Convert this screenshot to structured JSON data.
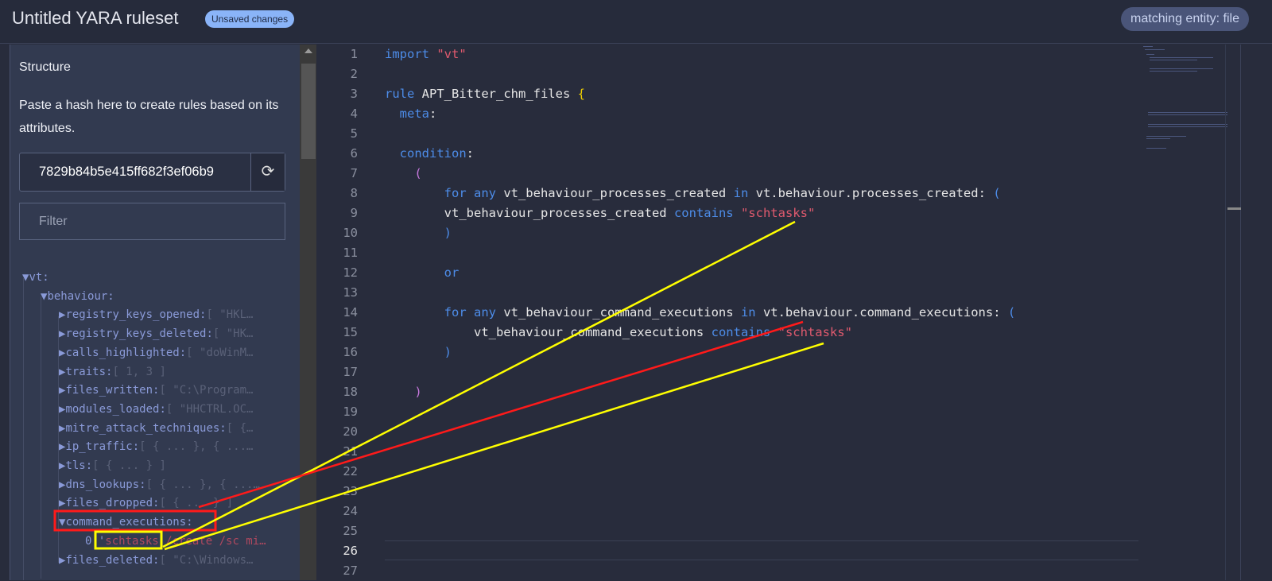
{
  "header": {
    "title": "Untitled YARA ruleset",
    "badge": "Unsaved changes",
    "entity": "matching entity: file"
  },
  "sidebar": {
    "heading": "Structure",
    "description": "Paste a hash here to create rules based on its attributes.",
    "hash_value": "7829b84b5e415ff682f3ef06b9",
    "refresh_icon": "⟳",
    "filter_placeholder": "Filter"
  },
  "tree": [
    {
      "arrow": "▼",
      "key": "vt:",
      "val": "",
      "level": 0
    },
    {
      "arrow": "▼",
      "key": "behaviour:",
      "val": "",
      "level": 1
    },
    {
      "arrow": "▶",
      "key": "registry_keys_opened:",
      "val": "[ \"HKL…",
      "level": 2
    },
    {
      "arrow": "▶",
      "key": "registry_keys_deleted:",
      "val": "[ \"HK…",
      "level": 2
    },
    {
      "arrow": "▶",
      "key": "calls_highlighted:",
      "val": "[ \"doWinM…",
      "level": 2
    },
    {
      "arrow": "▶",
      "key": "traits:",
      "val": "[ 1, 3 ]",
      "level": 2
    },
    {
      "arrow": "▶",
      "key": "files_written:",
      "val": "[ \"C:\\Program…",
      "level": 2
    },
    {
      "arrow": "▶",
      "key": "modules_loaded:",
      "val": "[ \"HHCTRL.OC…",
      "level": 2
    },
    {
      "arrow": "▶",
      "key": "mitre_attack_techniques:",
      "val": "[ {…",
      "level": 2
    },
    {
      "arrow": "▶",
      "key": "ip_traffic:",
      "val": "[ { ... }, { ...…",
      "level": 2
    },
    {
      "arrow": "▶",
      "key": "tls:",
      "val": "[ { ... } ]",
      "level": 2
    },
    {
      "arrow": "▶",
      "key": "dns_lookups:",
      "val": "[ { ... }, { ...…",
      "level": 2
    },
    {
      "arrow": "▶",
      "key": "files_dropped:",
      "val": "[ { ... } ]",
      "level": 2
    },
    {
      "arrow": "▼",
      "key": "command_executions:",
      "val": "",
      "level": 2
    },
    {
      "arrow": "",
      "key": "0:'",
      "val": "schtasks /create /sc mi…",
      "level": 3
    },
    {
      "arrow": "▶",
      "key": "files_deleted:",
      "val": "[ \"C:\\Windows…",
      "level": 2
    }
  ],
  "editor": {
    "line_numbers": [
      "1",
      "2",
      "3",
      "4",
      "5",
      "6",
      "7",
      "8",
      "9",
      "10",
      "11",
      "12",
      "13",
      "14",
      "15",
      "16",
      "17",
      "18",
      "19",
      "20",
      "21",
      "22",
      "23",
      "24",
      "25",
      "26",
      "27"
    ],
    "lines": [
      [
        [
          "kw",
          "import "
        ],
        [
          "st",
          "\"vt\""
        ]
      ],
      [],
      [
        [
          "kw",
          "rule "
        ],
        [
          "",
          "APT_Bitter_chm_files "
        ],
        [
          "br",
          "{"
        ]
      ],
      [
        [
          "",
          "  "
        ],
        [
          "kw",
          "meta"
        ],
        [
          "",
          ":"
        ]
      ],
      [],
      [
        [
          "",
          "  "
        ],
        [
          "kw",
          "condition"
        ],
        [
          "",
          ":"
        ]
      ],
      [
        [
          "",
          "    "
        ],
        [
          "pu",
          "("
        ]
      ],
      [
        [
          "",
          "        "
        ],
        [
          "kw",
          "for any "
        ],
        [
          "",
          "vt_behaviour_processes_created "
        ],
        [
          "kw",
          "in "
        ],
        [
          "",
          "vt.behaviour.processes_created: "
        ],
        [
          "kw",
          "("
        ]
      ],
      [
        [
          "",
          "        vt_behaviour_processes_created "
        ],
        [
          "kw",
          "contains "
        ],
        [
          "st",
          "\"schtasks\""
        ]
      ],
      [
        [
          "",
          "        "
        ],
        [
          "kw",
          ")"
        ]
      ],
      [],
      [
        [
          "",
          "        "
        ],
        [
          "kw",
          "or"
        ]
      ],
      [],
      [
        [
          "",
          "        "
        ],
        [
          "kw",
          "for any "
        ],
        [
          "",
          "vt_behaviour_command_executions "
        ],
        [
          "kw",
          "in "
        ],
        [
          "",
          "vt.behaviour.command_executions: "
        ],
        [
          "kw",
          "("
        ]
      ],
      [
        [
          "",
          "            vt_behaviour_command_executions "
        ],
        [
          "kw",
          "contains "
        ],
        [
          "st",
          "\"schtasks\""
        ]
      ],
      [
        [
          "",
          "        "
        ],
        [
          "kw",
          ")"
        ]
      ],
      [],
      [
        [
          "",
          "    "
        ],
        [
          "pu",
          ")"
        ]
      ],
      [],
      [],
      [],
      [],
      [],
      [],
      [],
      [],
      []
    ]
  },
  "annotations": {
    "yellow": "#ffff00",
    "red": "#ff1a1a"
  }
}
